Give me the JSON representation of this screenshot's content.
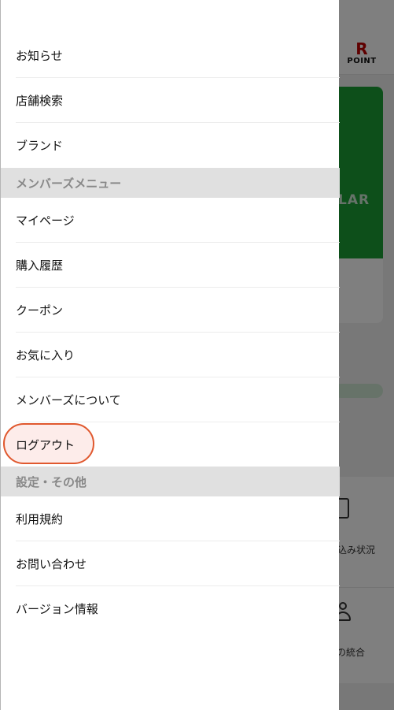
{
  "background": {
    "logo": {
      "letter": "R",
      "text": "POINT"
    },
    "card_text": "LAR",
    "feature_1": "込み状況",
    "feature_2": "の統合"
  },
  "drawer": {
    "items_top": [
      {
        "label": "お知らせ"
      },
      {
        "label": "店舗検索"
      },
      {
        "label": "ブランド"
      }
    ],
    "section_members": "メンバーズメニュー",
    "items_members": [
      {
        "label": "マイページ"
      },
      {
        "label": "購入履歴"
      },
      {
        "label": "クーポン"
      },
      {
        "label": "お気に入り"
      },
      {
        "label": "メンバーズについて"
      },
      {
        "label": "ログアウト"
      }
    ],
    "section_settings": "設定・その他",
    "items_settings": [
      {
        "label": "利用規約"
      },
      {
        "label": "お問い合わせ"
      },
      {
        "label": "バージョン情報"
      }
    ]
  },
  "colors": {
    "highlight_border": "#e0582e",
    "section_bg": "#e0e0e0",
    "brand_green": "#1a9e35",
    "brand_red": "#bf0000"
  }
}
